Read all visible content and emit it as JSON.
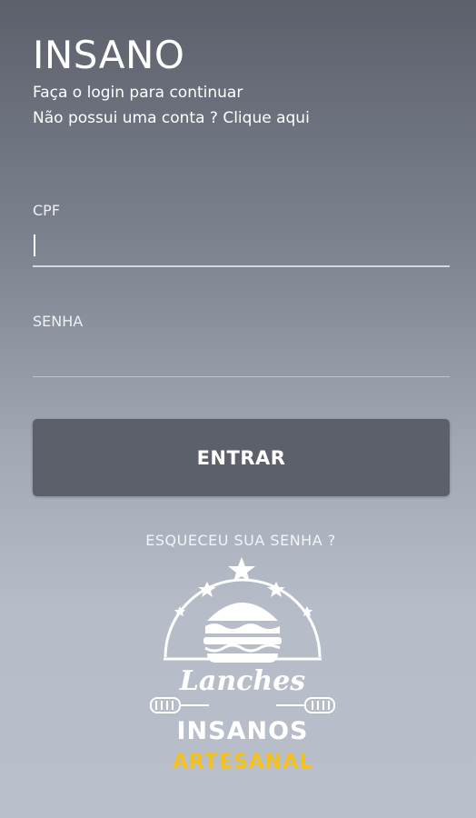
{
  "header": {
    "title": "INSANO",
    "subtitle_line1": "Faça o login para continuar",
    "subtitle_line2": "Não possui uma conta ? Clique aqui"
  },
  "form": {
    "cpf": {
      "label": "CPF",
      "value": ""
    },
    "senha": {
      "label": "SENHA",
      "value": ""
    },
    "submit_label": "ENTRAR",
    "forgot_label": "ESQUECEU SUA SENHA ?"
  },
  "logo": {
    "line1": "Lanches",
    "line2": "INSANOS",
    "line3": "ARTESANAL",
    "accent_color": "#f4c21a"
  },
  "colors": {
    "button_bg": "#5c606a",
    "background_top": "#5c606b",
    "background_bottom": "#b9bfca"
  }
}
